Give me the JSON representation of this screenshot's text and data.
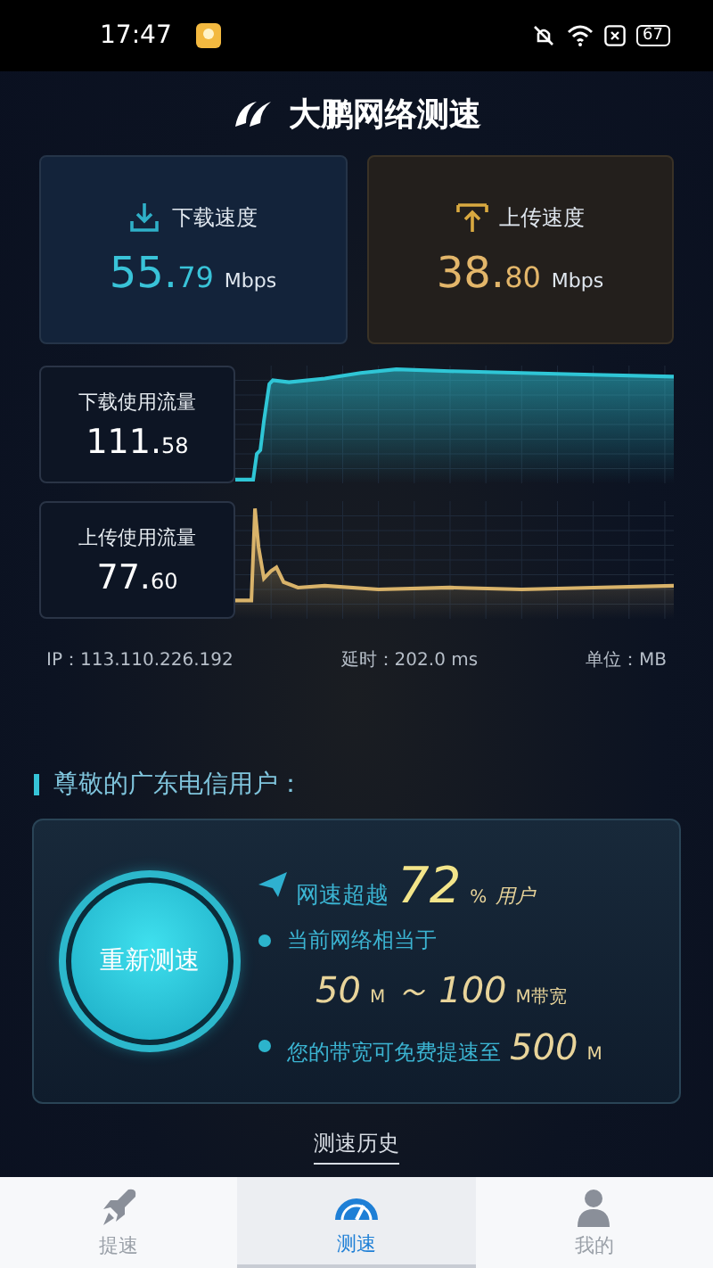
{
  "status_bar": {
    "time": "17:47",
    "battery": "67"
  },
  "title": "大鹏网络测速",
  "speeds": [
    {
      "kind": "download",
      "label": "下载速度",
      "value_main": "55.",
      "value_fraction": "79",
      "unit": "Mbps"
    },
    {
      "kind": "upload",
      "label": "上传速度",
      "value_main": "38.",
      "value_fraction": "80",
      "unit": "Mbps"
    }
  ],
  "traffic": [
    {
      "kind": "download",
      "label": "下载使用流量",
      "value_main": "111.",
      "value_fraction": "58"
    },
    {
      "kind": "upload",
      "label": "上传使用流量",
      "value_main": "77.",
      "value_fraction": "60"
    }
  ],
  "info": {
    "ip": "IP：113.110.226.192",
    "latency": "延时：202.0 ms",
    "unit": "单位：MB"
  },
  "greeting": "尊敬的广东电信用户：",
  "result": {
    "button": "重新测速",
    "lines": [
      {
        "kind": "rank",
        "text": "网速超越",
        "value": "72",
        "unit": "%",
        "suffix": "用户"
      },
      {
        "kind": "note",
        "text": "当前网络相当于"
      },
      {
        "kind": "range",
        "low": "50",
        "low_unit": "M",
        "separator": "～",
        "high": "100",
        "high_unit": "M带宽"
      },
      {
        "kind": "upgrade",
        "text": "您的带宽可免费提速至",
        "value": "500",
        "unit": "M"
      }
    ]
  },
  "history_link": "测速历史",
  "nav": [
    {
      "kind": "rocket",
      "label": "提速",
      "selected": false
    },
    {
      "kind": "gauge",
      "label": "测速",
      "selected": true
    },
    {
      "kind": "person",
      "label": "我的",
      "selected": false
    }
  ]
}
